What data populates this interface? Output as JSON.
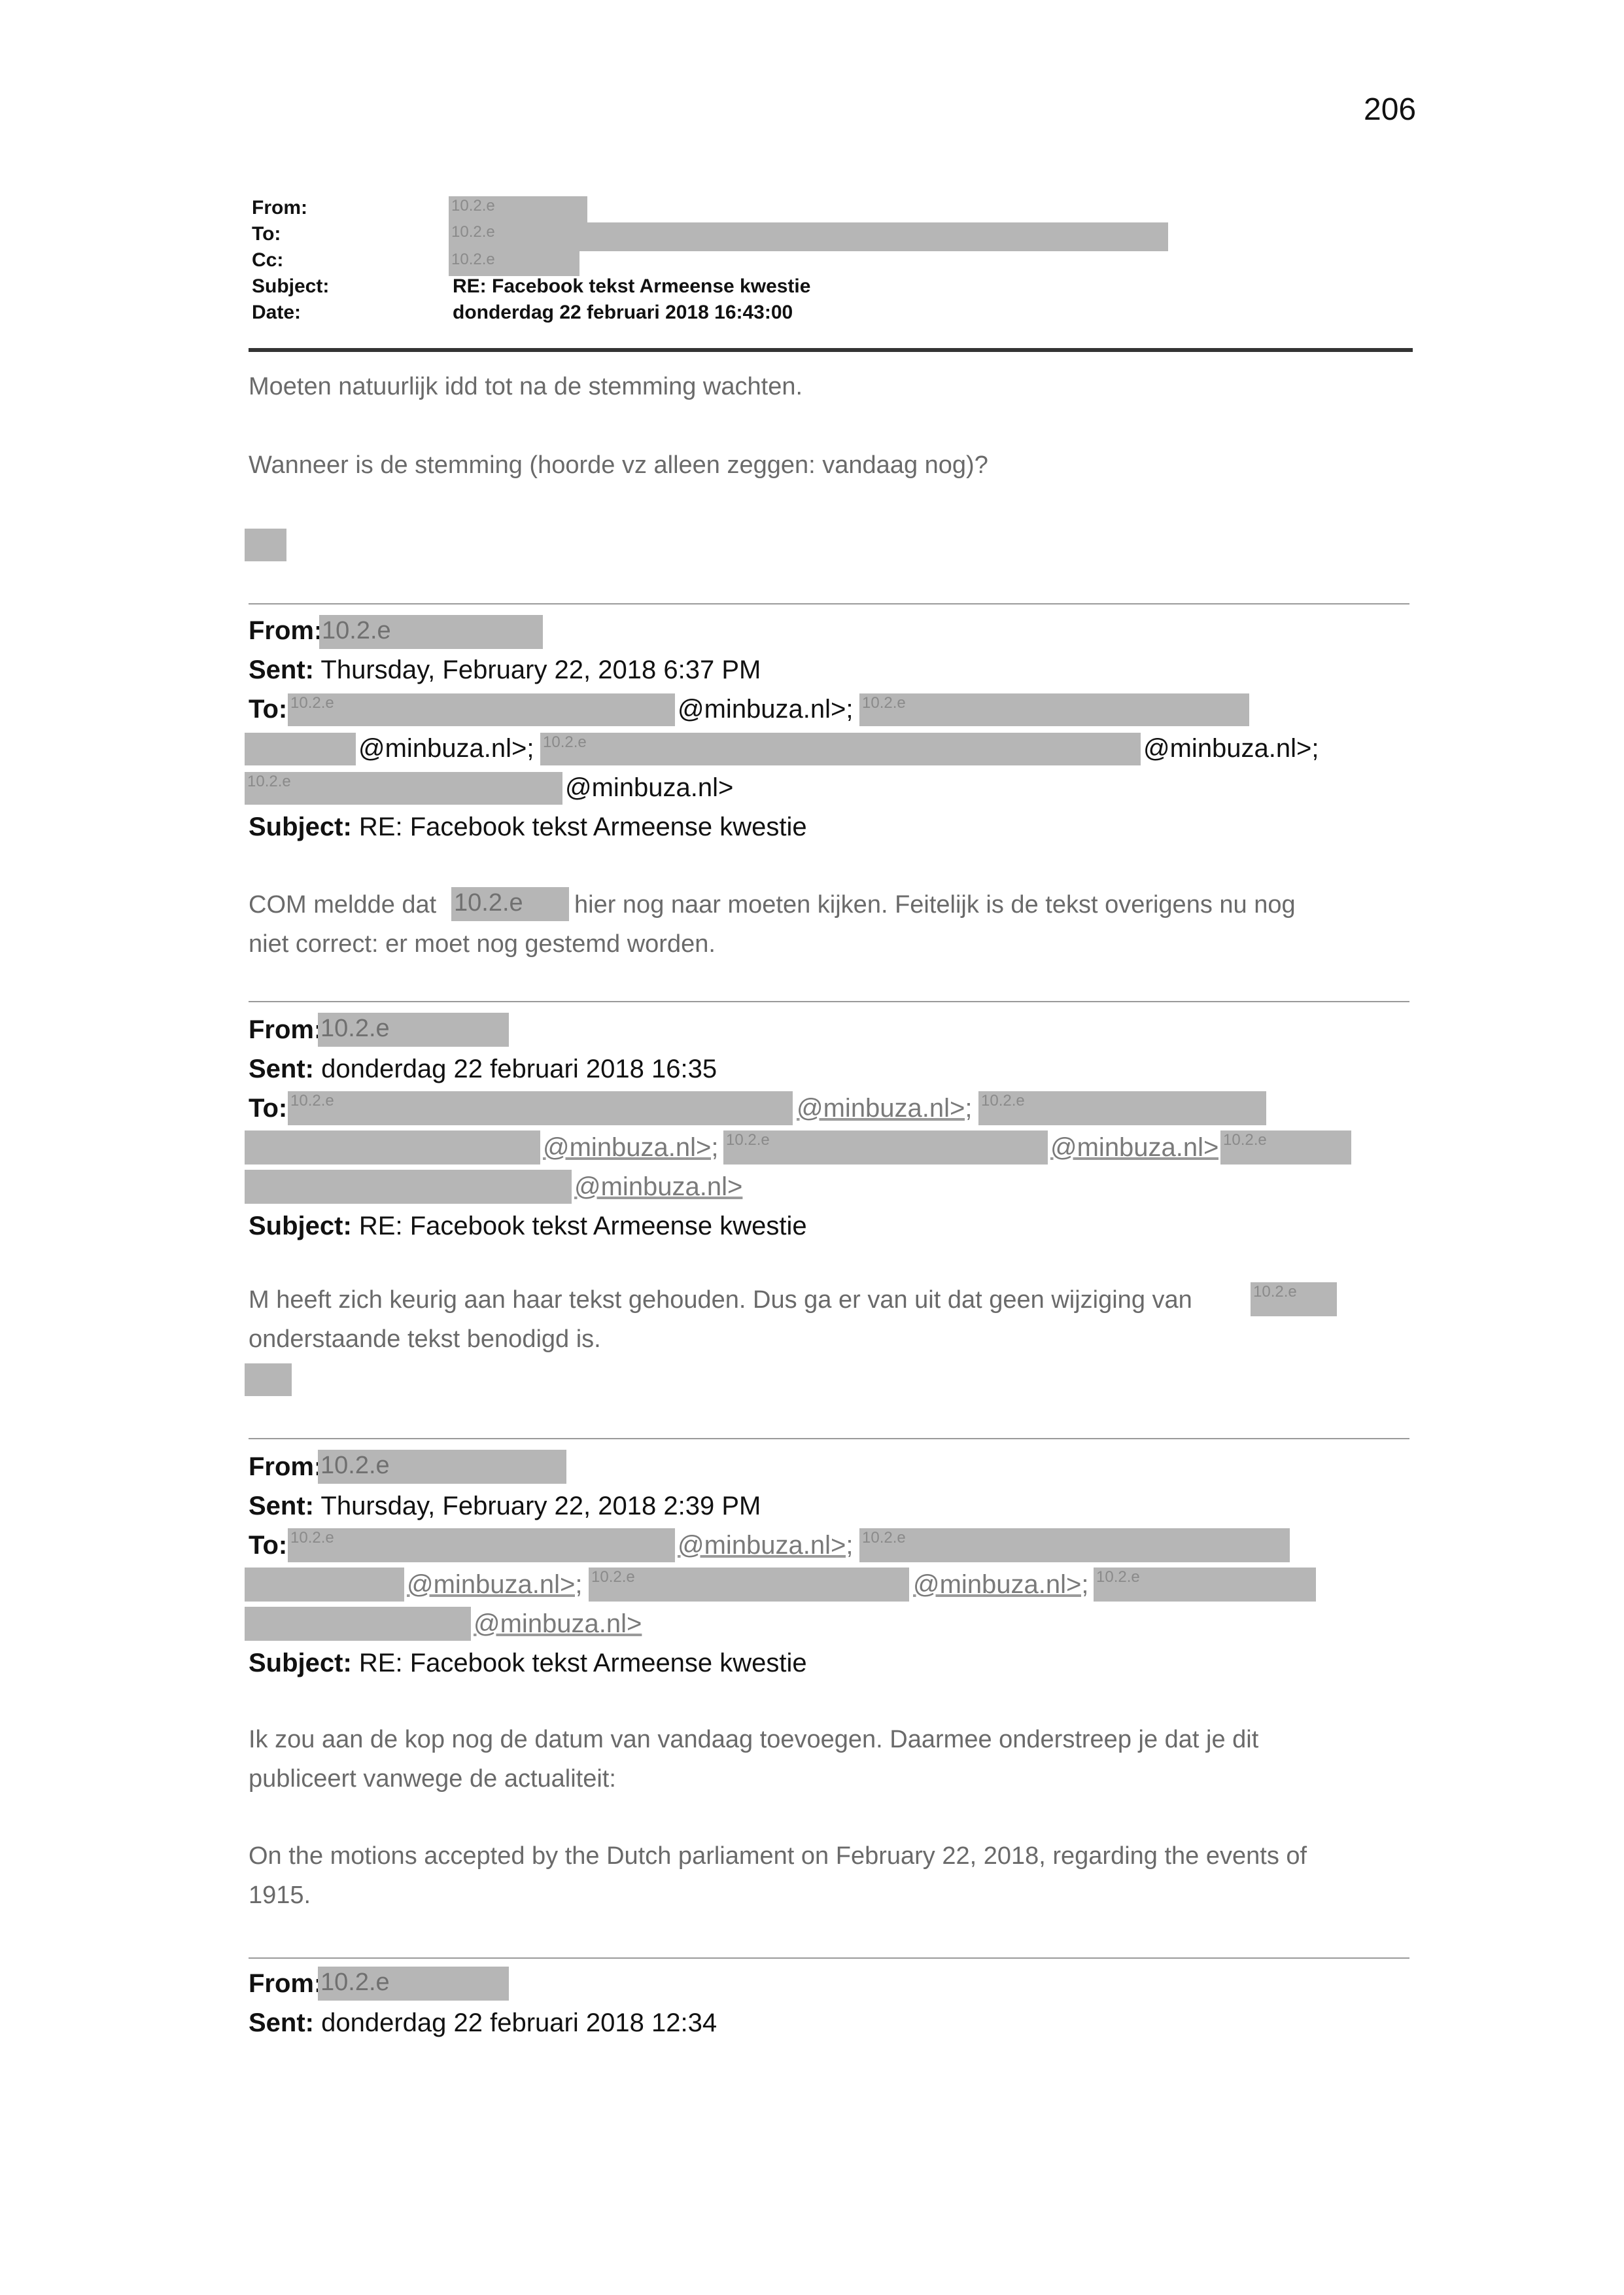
{
  "page_number": "206",
  "header": {
    "labels": [
      "From:",
      "To:",
      "Cc:",
      "Subject:",
      "Date:"
    ],
    "redaction_code": "10.2.e",
    "subject": "RE: Facebook tekst Armeense kwestie",
    "date": "donderdag 22 februari 2018 16:43:00"
  },
  "message1": {
    "lines": [
      "Moeten natuurlijk idd tot na de stemming wachten.",
      "Wanneer is de stemming (hoorde vz alleen zeggen: vandaag nog)?"
    ]
  },
  "labels": {
    "from": "From:",
    "sent": "Sent:",
    "to": "To:",
    "subject": "Subject:"
  },
  "redaction_code": "10.2.e",
  "email_domain_semi": "@minbuza.nl>;",
  "email_domain_end": "@minbuza.nl>",
  "message2": {
    "sent": "Thursday, February 22, 2018 6:37 PM",
    "subject": "RE: Facebook tekst Armeense kwestie",
    "body_line1_before": "COM meldde dat",
    "body_line1_after": "hier nog naar moeten kijken. Feitelijk is de tekst overigens nu nog",
    "body_line2": "niet correct: er moet nog gestemd worden."
  },
  "message3": {
    "sent": "donderdag 22 februari 2018 16:35",
    "subject": "RE: Facebook tekst Armeense kwestie",
    "body_line1": "M heeft zich keurig aan haar tekst gehouden. Dus ga er van uit dat geen wijziging van",
    "body_line2": "onderstaande tekst benodigd is."
  },
  "message4": {
    "sent": "Thursday, February 22, 2018 2:39 PM",
    "subject": "RE: Facebook tekst Armeense kwestie",
    "body_line1": "Ik zou aan de kop nog de datum van vandaag toevoegen. Daarmee onderstreep je dat je dit",
    "body_line2": "publiceert vanwege de actualiteit:",
    "body_line3": "On the motions accepted by the Dutch parliament on February 22, 2018, regarding the events of",
    "body_line4": "1915."
  },
  "message5": {
    "sent": "donderdag 22 februari 2018 12:34"
  }
}
